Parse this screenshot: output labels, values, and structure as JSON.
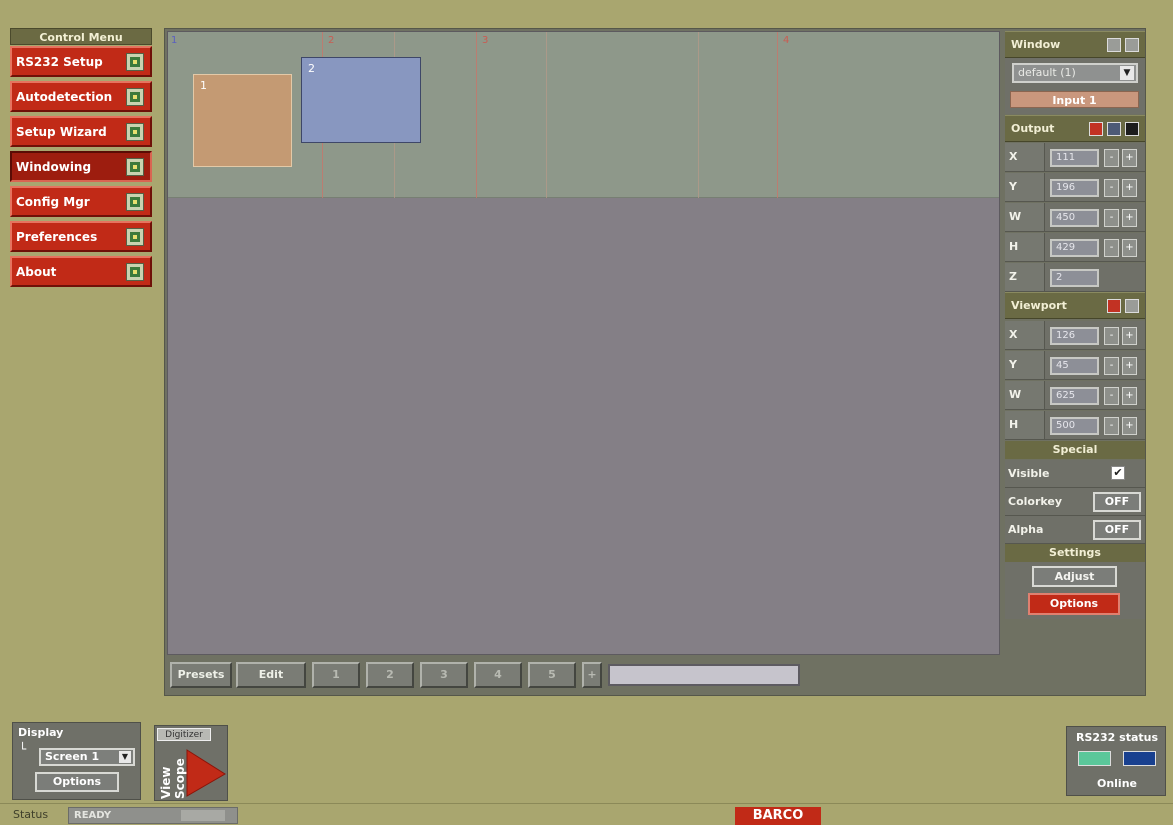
{
  "control_menu": {
    "title": "Control Menu",
    "items": [
      {
        "label": "RS232 Setup",
        "icon": "rs232-setup-icon",
        "active": false
      },
      {
        "label": "Autodetection",
        "icon": "autodetection-icon",
        "active": false
      },
      {
        "label": "Setup Wizard",
        "icon": "setup-wizard-icon",
        "active": false
      },
      {
        "label": "Windowing",
        "icon": "windowing-icon",
        "active": true
      },
      {
        "label": "Config Mgr",
        "icon": "config-mgr-icon",
        "active": false
      },
      {
        "label": "Preferences",
        "icon": "preferences-icon",
        "active": false
      },
      {
        "label": "About",
        "icon": "about-icon",
        "active": false
      }
    ]
  },
  "canvas": {
    "screen_numbers": [
      "1",
      "2",
      "3",
      "4"
    ],
    "windows": [
      {
        "label": "1",
        "color": "#c49a73"
      },
      {
        "label": "2",
        "color": "#8897c0"
      }
    ]
  },
  "presets": {
    "label": "Presets",
    "edit_label": "Edit",
    "slots": [
      "1",
      "2",
      "3",
      "4",
      "5",
      "+"
    ],
    "name_value": ""
  },
  "window_panel": {
    "title": "Window",
    "selected": "default (1)",
    "input_label": "Input 1"
  },
  "output_panel": {
    "title": "Output",
    "fields": [
      {
        "label": "X",
        "value": "111"
      },
      {
        "label": "Y",
        "value": "196"
      },
      {
        "label": "W",
        "value": "450"
      },
      {
        "label": "H",
        "value": "429"
      },
      {
        "label": "Z",
        "value": "2"
      }
    ]
  },
  "viewport_panel": {
    "title": "Viewport",
    "fields": [
      {
        "label": "X",
        "value": "126"
      },
      {
        "label": "Y",
        "value": "45"
      },
      {
        "label": "W",
        "value": "625"
      },
      {
        "label": "H",
        "value": "500"
      }
    ]
  },
  "special_panel": {
    "title": "Special",
    "visible_label": "Visible",
    "visible_checked": true,
    "colorkey_label": "Colorkey",
    "colorkey_value": "OFF",
    "alpha_label": "Alpha",
    "alpha_value": "OFF"
  },
  "settings_panel": {
    "title": "Settings",
    "adjust_label": "Adjust",
    "options_label": "Options"
  },
  "spin": {
    "minus": "-",
    "plus": "+"
  },
  "display_panel": {
    "title": "Display",
    "tree_glyph": "└",
    "screen_value": "Screen 1",
    "options_label": "Options"
  },
  "viewscope": {
    "tab_label": "Digitizer",
    "logo_text": "View Scope"
  },
  "rs232_status": {
    "title": "RS232 status",
    "state": "Online"
  },
  "status_bar": {
    "label": "Status",
    "value": "READY"
  },
  "brand": "BARCO",
  "colors": {
    "accent_red": "#c12a17",
    "panel_olive": "#6a6a44",
    "background": "#a9a66f"
  }
}
